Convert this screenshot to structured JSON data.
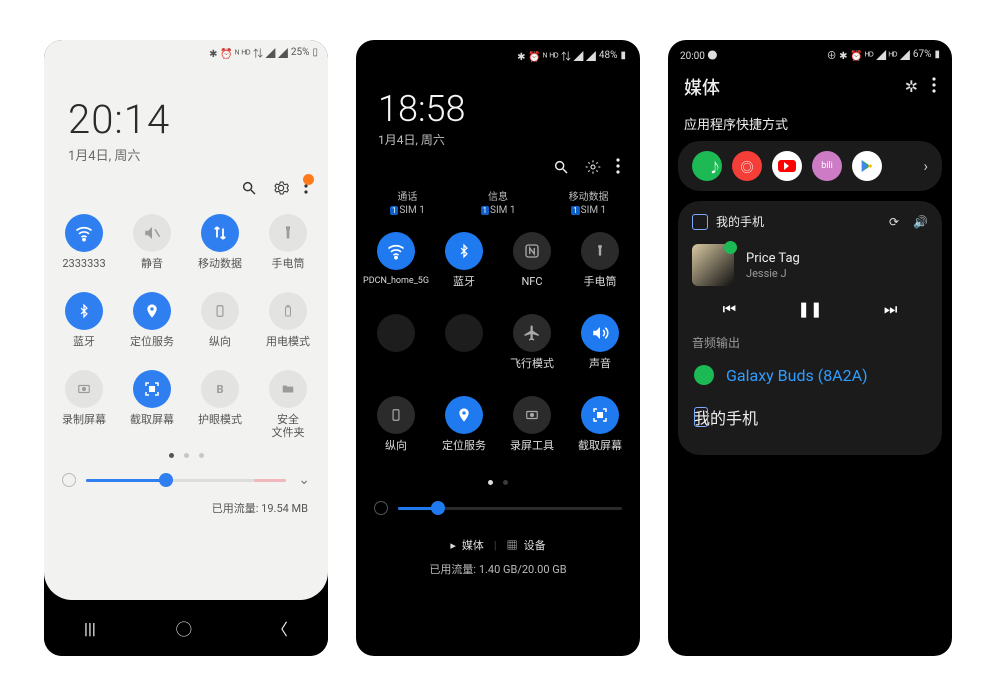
{
  "phone1": {
    "status_bar": {
      "icons": "✱ ⏰ ᴺ ᴴᴰ ⇅ ◢ ◢",
      "battery": "25%"
    },
    "time": "20:14",
    "date": "1月4日, 周六",
    "top_icons": {
      "search": "search",
      "settings": "settings",
      "more": "more"
    },
    "tiles": [
      {
        "label": "2333333",
        "on": true,
        "glyph": "wifi"
      },
      {
        "label": "静音",
        "on": false,
        "glyph": "mute"
      },
      {
        "label": "移动数据",
        "on": true,
        "glyph": "data"
      },
      {
        "label": "手电筒",
        "on": false,
        "glyph": "torch"
      },
      {
        "label": "蓝牙",
        "on": true,
        "glyph": "bt"
      },
      {
        "label": "定位服务",
        "on": true,
        "glyph": "loc"
      },
      {
        "label": "纵向",
        "on": false,
        "glyph": "portrait"
      },
      {
        "label": "用电模式",
        "on": false,
        "glyph": "battery"
      },
      {
        "label": "录制屏幕",
        "on": false,
        "glyph": "rec"
      },
      {
        "label": "截取屏幕",
        "on": true,
        "glyph": "shot"
      },
      {
        "label": "护眼模式",
        "on": false,
        "glyph": "eye"
      },
      {
        "label": "安全\n文件夹",
        "on": false,
        "glyph": "folder"
      }
    ],
    "pager": {
      "total": 3,
      "active": 0
    },
    "brightness": {
      "percent": 40
    },
    "traffic_label": "已用流量: 19.54 MB"
  },
  "phone2": {
    "status_bar": {
      "icons": "✱ ⏰ ᴺ ᴴᴰ ⇅ ◢ ◢",
      "battery": "48%"
    },
    "time": "18:58",
    "date": "1月4日, 周六",
    "sim_row": [
      {
        "title": "通话",
        "sim": "SIM 1"
      },
      {
        "title": "信息",
        "sim": "SIM 1"
      },
      {
        "title": "移动数据",
        "sim": "SIM 1"
      }
    ],
    "tiles": [
      {
        "label": "PDCN_home_5G",
        "state": "on",
        "glyph": "wifi"
      },
      {
        "label": "蓝牙",
        "state": "on",
        "glyph": "bt"
      },
      {
        "label": "NFC",
        "state": "off",
        "glyph": "nfc"
      },
      {
        "label": "手电筒",
        "state": "off",
        "glyph": "torch"
      },
      {
        "label": "",
        "state": "dim",
        "glyph": ""
      },
      {
        "label": "",
        "state": "dim",
        "glyph": ""
      },
      {
        "label": "飞行模式",
        "state": "off",
        "glyph": "plane"
      },
      {
        "label": "声音",
        "state": "on",
        "glyph": "sound"
      },
      {
        "label": "纵向",
        "state": "off",
        "glyph": "portrait"
      },
      {
        "label": "定位服务",
        "state": "on",
        "glyph": "loc"
      },
      {
        "label": "录屏工具",
        "state": "off",
        "glyph": "rec"
      },
      {
        "label": "截取屏幕",
        "state": "on",
        "glyph": "shot"
      }
    ],
    "pager": {
      "total": 2,
      "active": 0
    },
    "brightness": {
      "percent": 18
    },
    "bottom_menu": {
      "media": "媒体",
      "devices": "设备"
    },
    "traffic_label": "已用流量: 1.40 GB/20.00 GB"
  },
  "phone3": {
    "status_bar": {
      "time": "20:00",
      "left_icon": "●",
      "icons": "⊕ ✱ ⏰ ᴴᴰ ◢ ᴴᴰ ◢",
      "battery": "67%"
    },
    "header": {
      "title": "媒体"
    },
    "section_title": "应用程序快捷方式",
    "apps": [
      "Spotify",
      "Pocket Casts",
      "YouTube",
      "bilibili",
      "Play Store"
    ],
    "media_card": {
      "device": "我的手机",
      "track_title": "Price Tag",
      "track_artist": "Jessie J",
      "controls": {
        "prev": "prev",
        "pause": "pause",
        "next": "next"
      },
      "output_title": "音频输出",
      "outputs": [
        {
          "label": "Galaxy Buds (8A2A)",
          "active": true,
          "kind": "buds"
        },
        {
          "label": "我的手机",
          "active": false,
          "kind": "phone"
        }
      ]
    }
  }
}
